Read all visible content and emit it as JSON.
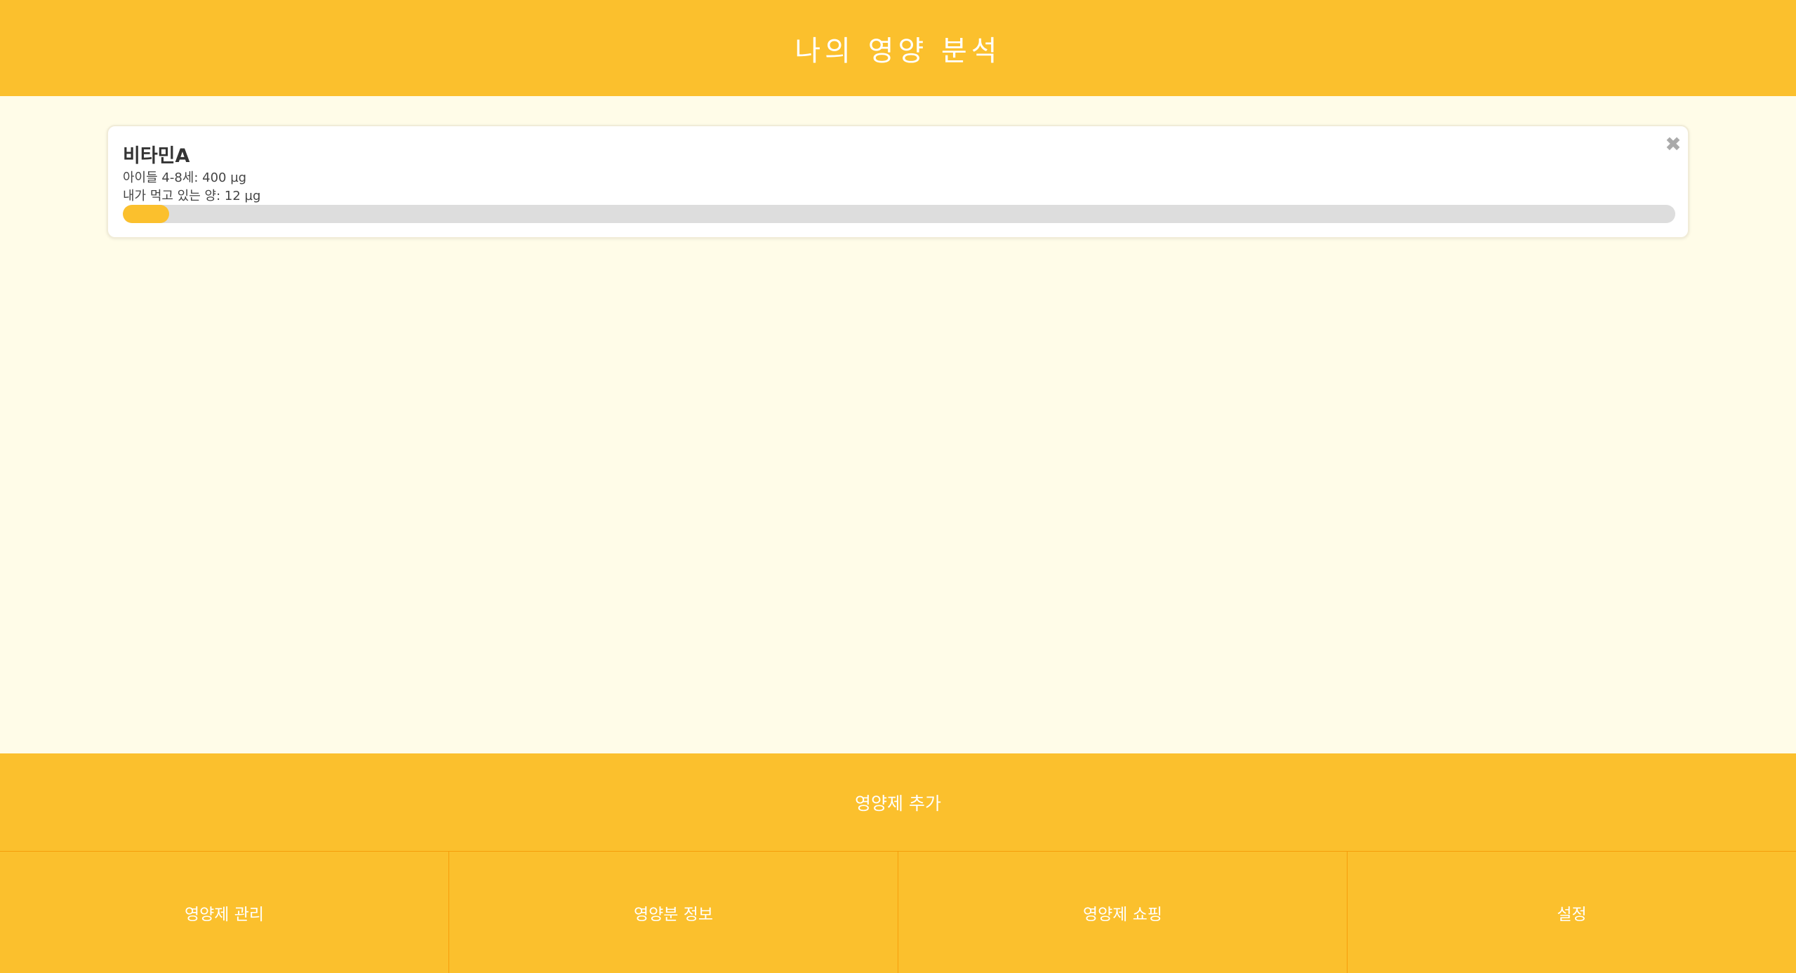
{
  "header": {
    "title": "나의 영양 분석"
  },
  "nutrients": [
    {
      "name": "비타민A",
      "recommended": "아이들 4-8세: 400 µg",
      "intake": "내가 먹고 있는 양: 12 µg",
      "progress_fraction": 0.03,
      "close_icon": "close-icon"
    }
  ],
  "add_button": {
    "label": "영양제 추가"
  },
  "tabs": [
    {
      "label": "영양제 관리"
    },
    {
      "label": "영양분 정보"
    },
    {
      "label": "영양제 쇼핑"
    },
    {
      "label": "설정"
    }
  ],
  "colors": {
    "accent": "#FBC02D",
    "background": "#FFFCE8",
    "track": "#DDDDDD"
  }
}
